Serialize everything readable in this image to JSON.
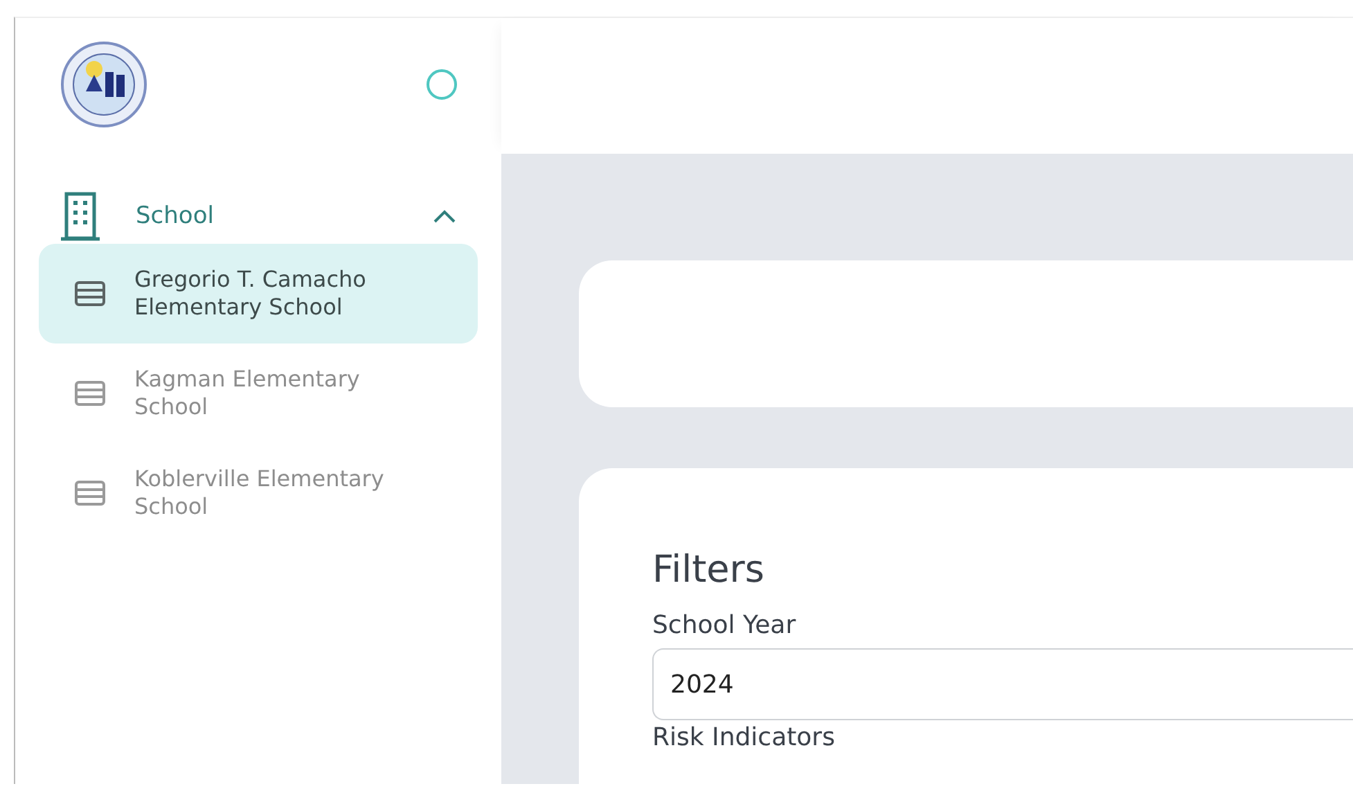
{
  "sidebar": {
    "group": {
      "label": "School",
      "expanded": true,
      "items": [
        {
          "label": "Gregorio T. Camacho Elementary School",
          "selected": true
        },
        {
          "label": "Kagman Elementary School",
          "selected": false
        },
        {
          "label": "Koblerville Elementary School",
          "selected": false
        }
      ]
    }
  },
  "filters": {
    "title": "Filters",
    "fields": [
      {
        "label": "School Year",
        "value": "2024"
      }
    ],
    "next_label": "Risk Indicators"
  }
}
